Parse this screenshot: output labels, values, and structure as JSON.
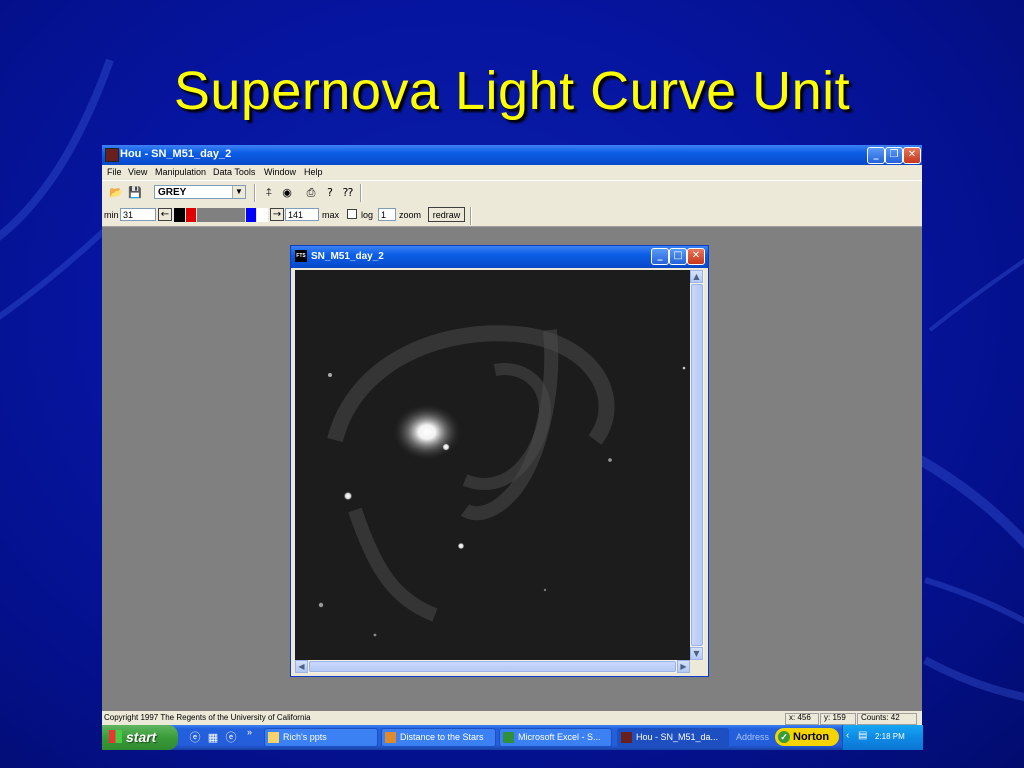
{
  "slide": {
    "title": "Supernova Light Curve Unit"
  },
  "app": {
    "title": "Hou - SN_M51_day_2",
    "menu": [
      "File",
      "View",
      "Manipulation",
      "Data Tools",
      "Window",
      "Help"
    ],
    "toolbar": {
      "palette": "GREY",
      "min_label": "min",
      "min_value": "31",
      "max_value": "141",
      "max_label": "max",
      "log_label": "log",
      "zoom_value": "1",
      "zoom_label": "zoom",
      "redraw_label": "redraw"
    },
    "image_window": {
      "title": "SN_M51_day_2",
      "badge": "FTS"
    },
    "status": {
      "copyright": "Copyright 1997 The Regents of the University of California",
      "x": "x: 456",
      "y": "y: 159",
      "counts": "Counts: 42"
    }
  },
  "taskbar": {
    "start_label": "start",
    "tasks": [
      "Rich's ppts",
      "Distance to the Stars",
      "Microsoft Excel - S...",
      "Hou - SN_M51_da..."
    ],
    "address_label": "Address",
    "norton_label": "Norton",
    "clock": "2:18 PM"
  },
  "colors": {
    "title_yellow": "#ffff00",
    "slide_blue": "#0615a0",
    "xp_blue": "#0a5ee6"
  }
}
